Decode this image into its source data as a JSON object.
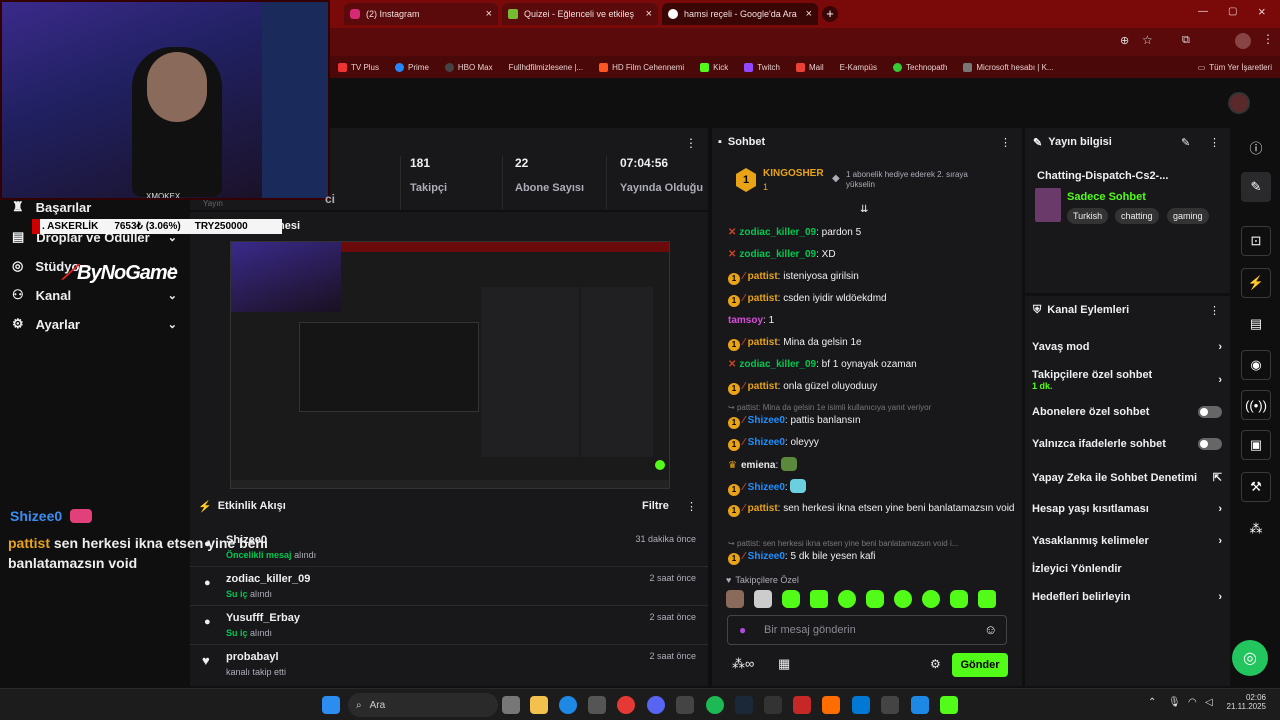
{
  "browser": {
    "tabs": [
      {
        "label": "(2) Instagram"
      },
      {
        "label": "Quizei - Eğlenceli ve etkileşim..."
      },
      {
        "label": "hamsi reçeli - Google'da Ara"
      }
    ],
    "bookmarks": [
      "TV Plus",
      "Prime",
      "HBO Max",
      "Fullhdfilmizlesene |...",
      "HD Film Cehennemi",
      "Kick",
      "Twitch",
      "Mail",
      "E-Kampüs",
      "Technopath",
      "Microsoft hesabı | K...",
      "Tüm Yer İşaretleri"
    ]
  },
  "overlay": {
    "cam_name": "XMOKEX",
    "ticker_prefix": ". ASKERLİK",
    "ticker_value": "7653₺ (3.06%)",
    "ticker_goal": "TRY250000",
    "brand": "ByNoGame",
    "chat_user": "Shizee0",
    "chat_user2": "pattist",
    "chat_text": "sen herkesi ikna etsen yine beni banlatamazsın void",
    "partial_nesi": "nesi",
    "partial_yayin": "Yayın",
    "partial_ci": "ci"
  },
  "sidebar": {
    "items": [
      {
        "label": "Başarılar",
        "icon": "trophy-icon"
      },
      {
        "label": "Droplar ve Ödüller",
        "icon": "gift-icon"
      },
      {
        "label": "Stüdyo",
        "icon": "studio-icon"
      },
      {
        "label": "Kanal",
        "icon": "people-icon"
      },
      {
        "label": "Ayarlar",
        "icon": "gear-icon"
      }
    ]
  },
  "stats": [
    {
      "value": "181",
      "label": "Takipçi"
    },
    {
      "value": "22",
      "label": "Abone Sayısı"
    },
    {
      "value": "07:04:56",
      "label": "Yayında Olduğu"
    }
  ],
  "activity": {
    "title": "Etkinlik Akışı",
    "filter": "Filtre",
    "rows": [
      {
        "name": "Shizee0",
        "highlight": "Öncelikli mesaj",
        "rest": "alındı",
        "time": "31 dakika önce"
      },
      {
        "name": "zodiac_killer_09",
        "highlight": "Su iç",
        "rest": "alındı",
        "time": "2 saat önce"
      },
      {
        "name": "Yusufff_Erbay",
        "highlight": "Su iç",
        "rest": "alındı",
        "time": "2 saat önce"
      },
      {
        "name": "probabayl",
        "highlight": "",
        "rest": "kanalı takip etti",
        "time": "2 saat önce"
      }
    ]
  },
  "chat": {
    "title": "Sohbet",
    "top_user": "KINGOSHER",
    "top_rank": "1",
    "top_count": "1",
    "top_note": "1 abonelik hediye ederek 2. sıraya yükselin",
    "messages": [
      {
        "user": "zodiac_killer_09",
        "color": "#00c850",
        "text": "pardon 5"
      },
      {
        "user": "zodiac_killer_09",
        "color": "#00c850",
        "text": "XD"
      },
      {
        "user": "pattist",
        "color": "#e8a317",
        "text": "isteniyosa girilsin"
      },
      {
        "user": "pattist",
        "color": "#e8a317",
        "text": "csden iyidir wldöekdmd"
      },
      {
        "user": "tamsoy",
        "color": "#d84bd8",
        "text": "1"
      },
      {
        "user": "pattist",
        "color": "#e8a317",
        "text": "Mina da gelsin 1e"
      },
      {
        "user": "zodiac_killer_09",
        "color": "#00c850",
        "text": "bf 1 oynayak ozaman"
      },
      {
        "user": "pattist",
        "color": "#e8a317",
        "text": "onla güzel oluyoduuy"
      },
      {
        "reply": "pattist: Mina da gelsin 1e isimli kullanıcıya yanıt veriyor"
      },
      {
        "user": "Shizee0",
        "color": "#1e90ff",
        "text": "pattis banlansın"
      },
      {
        "user": "Shizee0",
        "color": "#1e90ff",
        "text": "oleyyy"
      },
      {
        "user": "emiena",
        "color": "#e8e8e8",
        "text": ""
      },
      {
        "user": "Shizee0",
        "color": "#1e90ff",
        "text": ""
      },
      {
        "user": "pattist",
        "color": "#e8a317",
        "text": "sen herkesi ikna etsen yine beni banlatamazsın void"
      },
      {
        "reply": "pattist: sen herkesi ikna etsen yine beni banlatamazsın void i..."
      },
      {
        "user": "Shizee0",
        "color": "#1e90ff",
        "text": "5 dk bile yesen kafi"
      }
    ],
    "followers_only": "Takipçilere Özel",
    "input_placeholder": "Bir mesaj gönderin",
    "send": "Gönder"
  },
  "stream_info": {
    "title": "Yayın bilgisi",
    "stream_title": "Chatting-Dispatch-Cs2-...",
    "category": "Sadece Sohbet",
    "tags": [
      "Turkish",
      "chatting",
      "gaming"
    ]
  },
  "channel_actions": {
    "title": "Kanal Eylemleri",
    "items": [
      {
        "label": "Yavaş mod",
        "type": "arrow"
      },
      {
        "label": "Takipçilere özel sohbet",
        "sub": "1 dk.",
        "type": "arrow"
      },
      {
        "label": "Abonelere özel sohbet",
        "type": "toggle"
      },
      {
        "label": "Yalnızca ifadelerle sohbet",
        "type": "toggle"
      },
      {
        "label": "Yapay Zeka ile Sohbet Denetimi",
        "type": "ext"
      },
      {
        "label": "Hesap yaşı kısıtlaması",
        "type": "arrow"
      },
      {
        "label": "Yasaklanmış kelimeler",
        "type": "arrow"
      },
      {
        "label": "İzleyici Yönlendir",
        "type": "none"
      },
      {
        "label": "Hedefleri belirleyin",
        "type": "arrow"
      }
    ]
  },
  "taskbar": {
    "search": "Ara",
    "time": "02:06",
    "date": "21.11.2025"
  },
  "colors": {
    "accent": "#53fc18",
    "chrome": "#7a0a0a",
    "panel": "#18181b"
  }
}
